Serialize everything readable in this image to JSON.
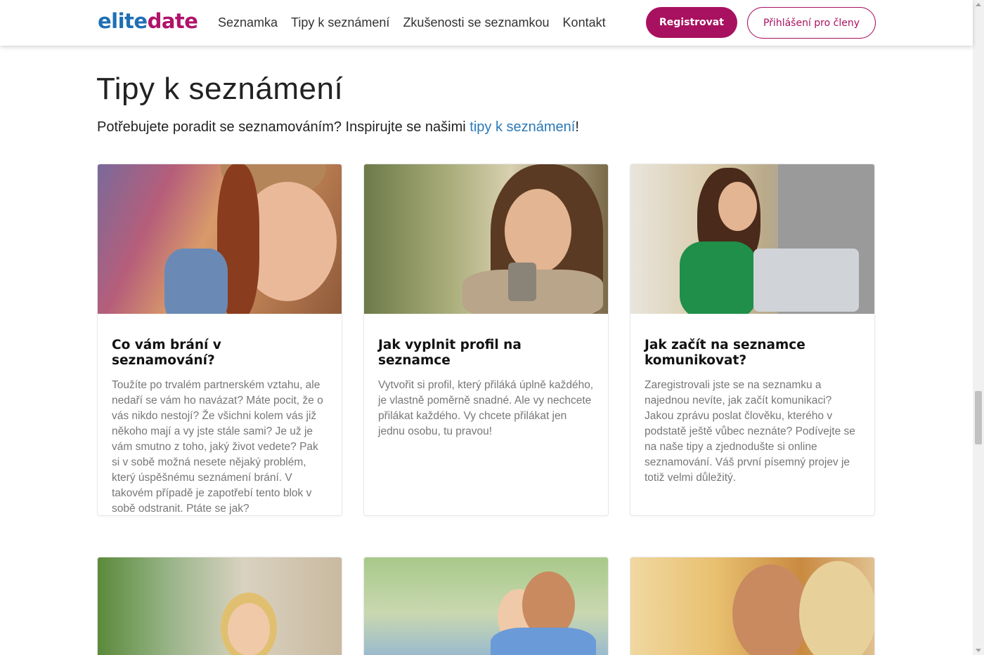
{
  "header": {
    "logo_part1": "elite",
    "logo_part2": "date",
    "nav": [
      "Seznamka",
      "Tipy k seznámení",
      "Zkušenosti se seznamkou",
      "Kontakt"
    ],
    "register_label": "Registrovat",
    "login_label": "Přihlášení pro členy"
  },
  "main": {
    "title": "Tipy k seznámení",
    "intro_before": "Potřebujete poradit se seznamováním? Inspirujte se našimi ",
    "intro_link": "tipy k seznámení",
    "intro_after": "!",
    "cards": [
      {
        "title": "Co vám brání v seznamování?",
        "text": "Toužíte po trvalém partnerském vztahu, ale nedaří se vám ho navázat? Máte pocit, že o vás nikdo nestojí? Že všichni kolem vás již někoho mají a vy jste stále sami? Je už je vám smutno z toho, jaký život vedete? Pak si v sobě možná nesete nějaký problém, který úspěšnému seznámení brání. V takovém případě je zapotřebí tento blok v sobě odstranit. Ptáte se jak?"
      },
      {
        "title": "Jak vyplnit profil na seznamce",
        "text": "Vytvořit si profil, který přiláká úplně každého, je vlastně poměrně snadné. Ale vy nechcete přilákat každého. Vy chcete přilákat jen jednu osobu, tu pravou!"
      },
      {
        "title": "Jak začít na seznamce komunikovat?",
        "text": "Zaregistrovali jste se na seznamku a najednou nevíte, jak začít komunikaci? Jakou zprávu poslat člověku, kterého v podstatě ještě vůbec neznáte? Podívejte se na naše tipy a zjednodušte si online seznamování. Váš první písemný projev je totiž velmi důležitý."
      }
    ]
  },
  "colors": {
    "brand_blue": "#1f6fb5",
    "brand_magenta": "#a8115f",
    "link": "#2a79b8"
  }
}
